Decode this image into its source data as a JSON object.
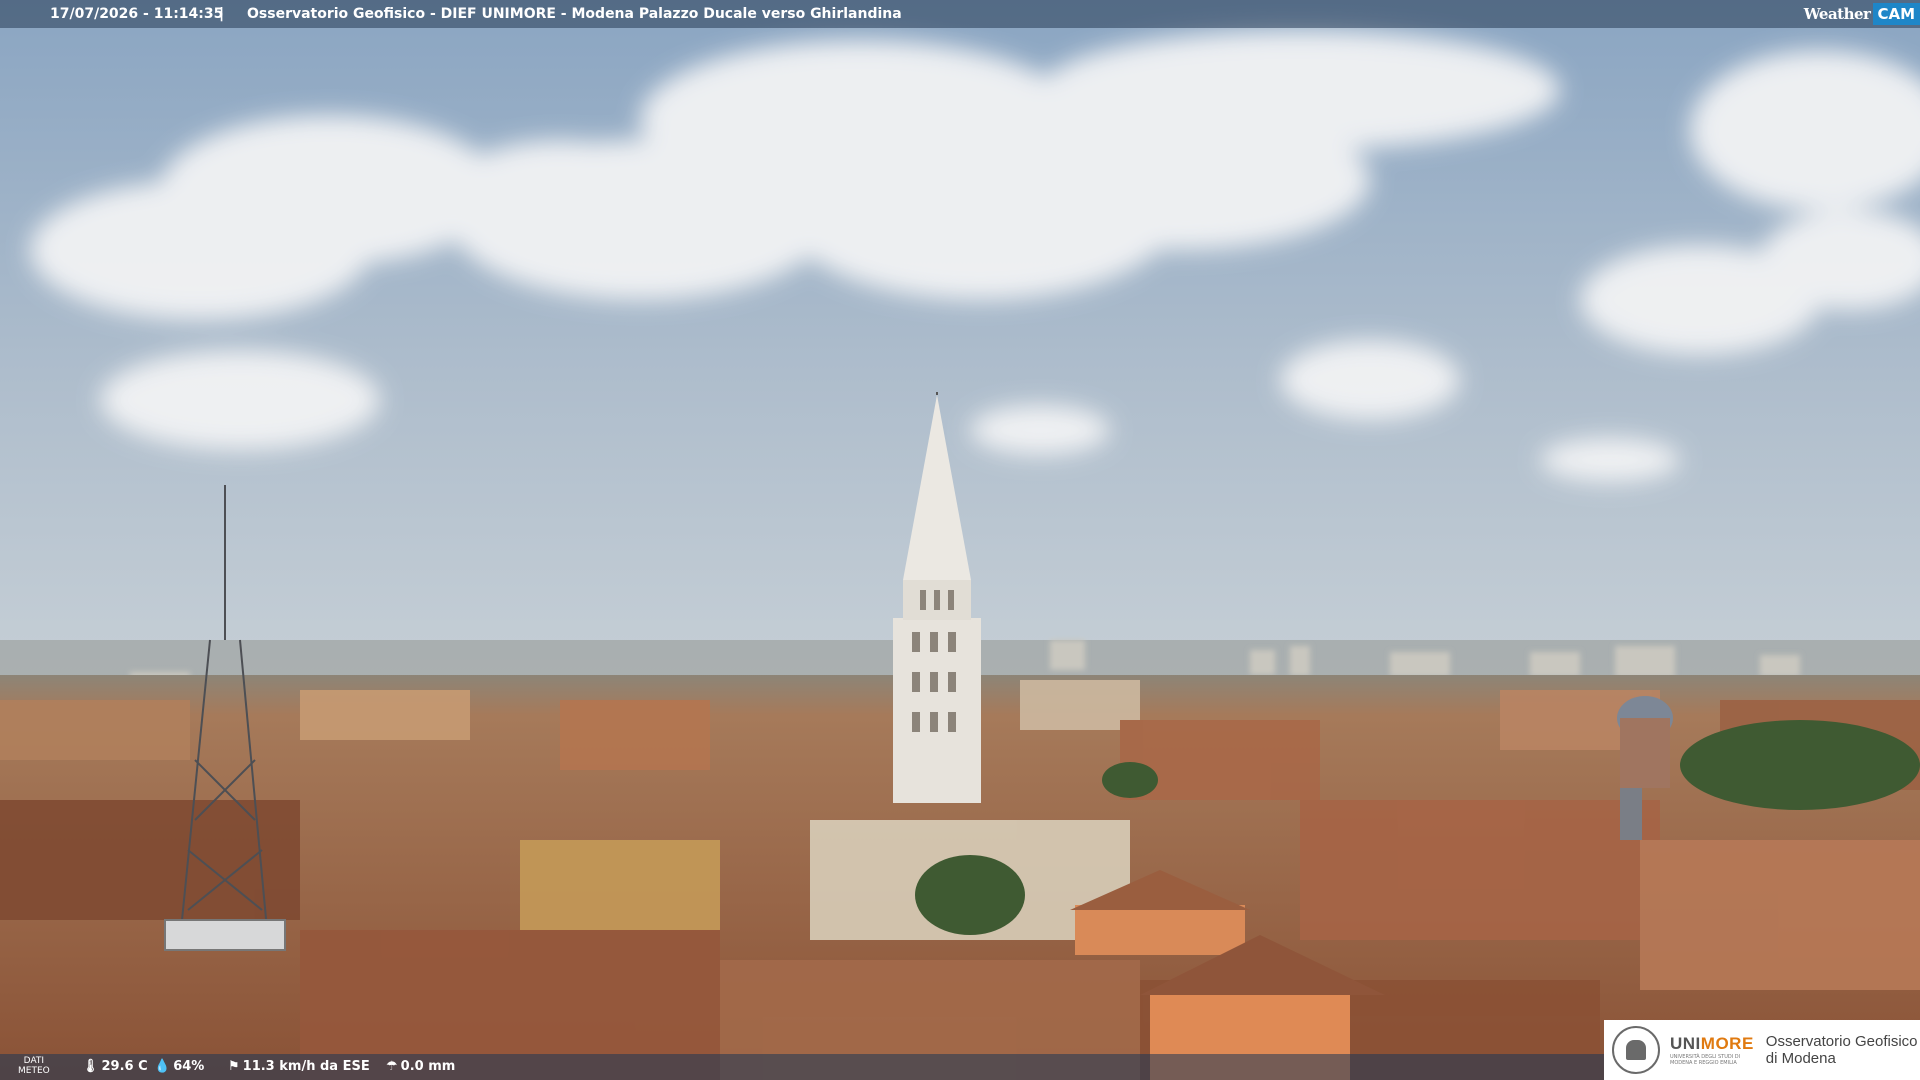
{
  "camera": {
    "timestamp": "17/07/2026 - 11:14:35",
    "separator": "|",
    "caption": "Osservatorio Geofisico - DIEF UNIMORE - Modena Palazzo Ducale verso Ghirlandina",
    "brand_word": "Weather",
    "brand_badge": "CAM"
  },
  "meteo": {
    "label_line1": "DATI",
    "label_line2": "METEO",
    "temperature": "29.6 C",
    "humidity": "64%",
    "wind": "11.3 km/h da ESE",
    "rain": "0.0 mm",
    "icons": [
      "thermometer-icon",
      "humidity-icon",
      "wind-icon",
      "rain-icon"
    ]
  },
  "logo": {
    "uni_prefix": "UNI",
    "uni_suffix": "MORE",
    "uni_sub": "UNIVERSITÀ DEGLI STUDI DI MODENA E REGGIO EMILIA",
    "obs_line1": "Osservatorio Geofisico",
    "obs_line2": "di Modena"
  },
  "colors": {
    "sky_top": "#8fa9c4",
    "sky_horizon": "#c3cdd6",
    "roofs": "#a0603a",
    "brand_blue": "#1e86c8",
    "unimore_orange": "#e07a10"
  }
}
